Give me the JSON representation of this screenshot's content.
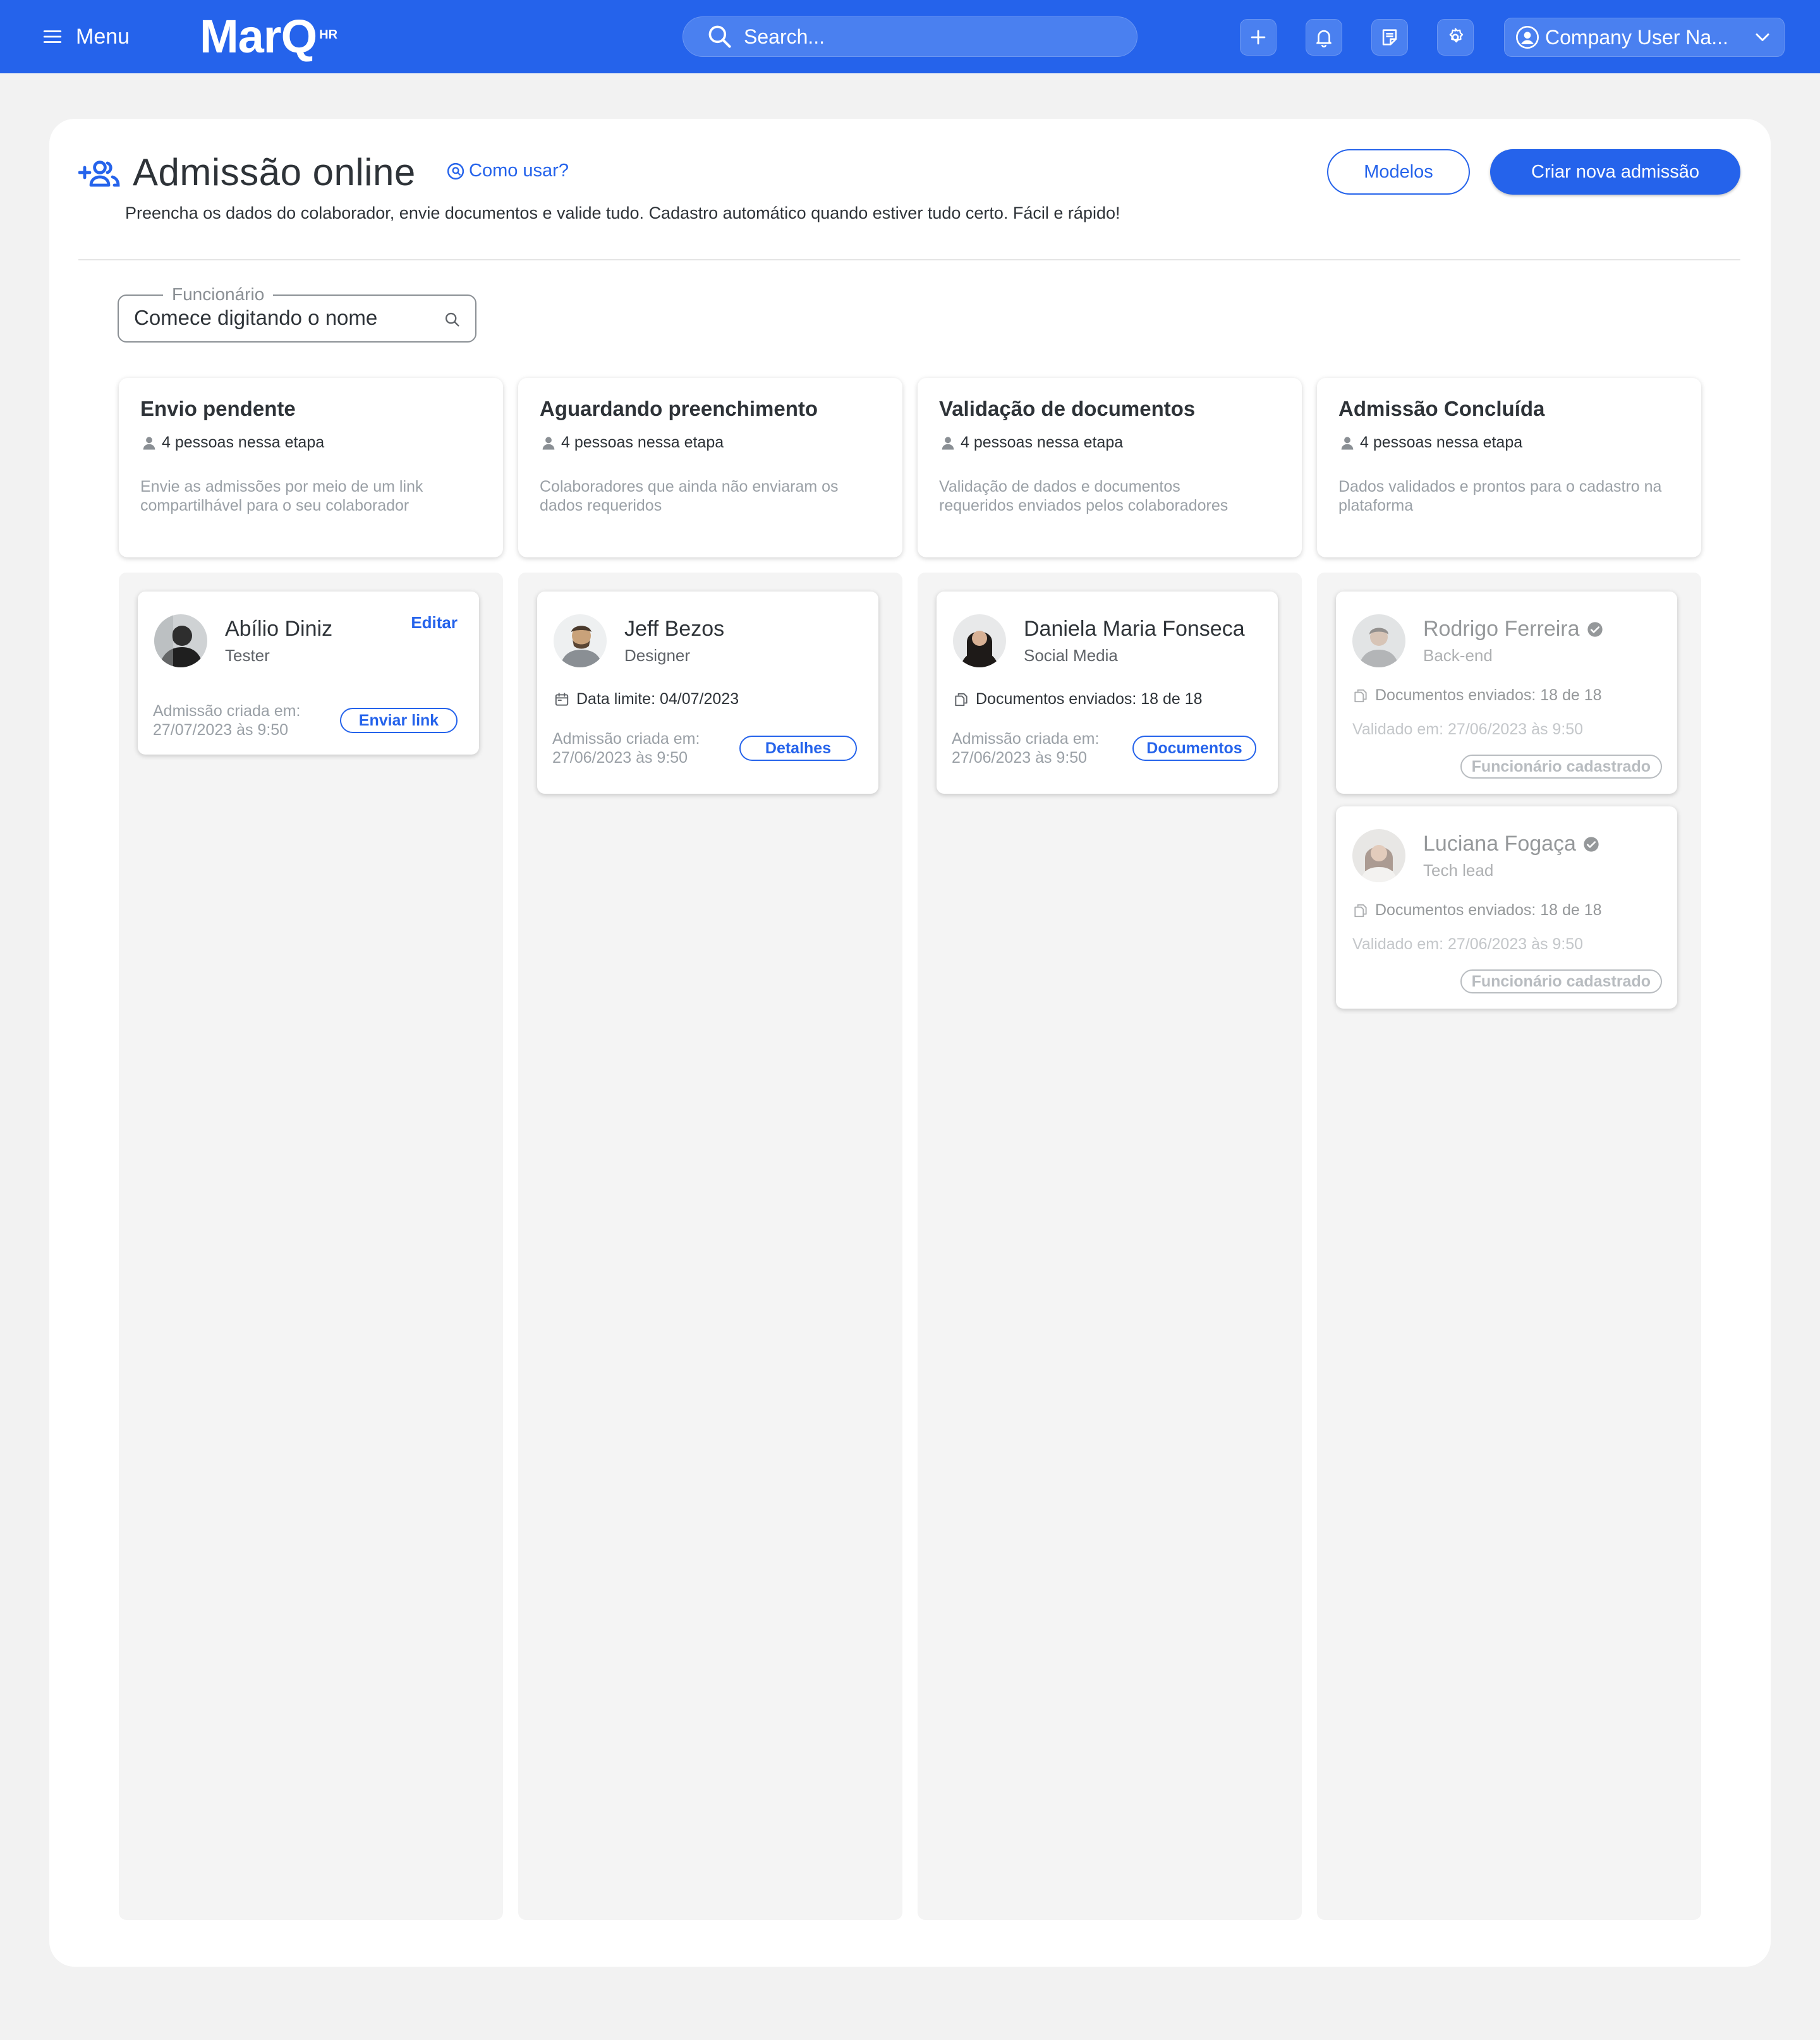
{
  "topbar": {
    "menu_label": "Menu",
    "logo_text": "MarQ",
    "logo_sup": "HR",
    "search_placeholder": "Search...",
    "user_name": "Company User Na...",
    "accent_color": "#2563eb"
  },
  "header": {
    "title": "Admissão online",
    "how_to": "Como usar?",
    "subtitle": "Preencha os dados do colaborador, envie documentos e valide tudo. Cadastro automático quando estiver tudo certo. Fácil e rápido!",
    "models_button": "Modelos",
    "create_button": "Criar nova admissão"
  },
  "filter": {
    "label": "Funcionário",
    "placeholder": "Comece digitando o nome"
  },
  "columns": [
    {
      "title": "Envio pendente",
      "count": "4 pessoas nessa etapa",
      "desc_1": "Envie as admissões por meio de um link",
      "desc_2": "compartilhável para o seu colaborador"
    },
    {
      "title": "Aguardando preenchimento",
      "count": "4 pessoas nessa etapa",
      "desc_1": "Colaboradores que ainda não enviaram os",
      "desc_2": "dados requeridos"
    },
    {
      "title": "Validação de documentos",
      "count": "4 pessoas nessa etapa",
      "desc_1": "Validação de dados e documentos",
      "desc_2": "requeridos enviados pelos colaboradores"
    },
    {
      "title": "Admissão Concluída",
      "count": "4 pessoas nessa etapa",
      "desc_1": "Dados validados e prontos para o cadastro na",
      "desc_2": "plataforma"
    }
  ],
  "cards": {
    "abilio": {
      "name": "Abílio Diniz",
      "role": "Tester",
      "edit": "Editar",
      "created_label": "Admissão criada em:",
      "created_date": "27/07/2023 às 9:50",
      "action": "Enviar link"
    },
    "jeff": {
      "name": "Jeff Bezos",
      "role": "Designer",
      "deadline_label": "Data limite:",
      "deadline_value": "04/07/2023",
      "created_label": "Admissão criada em:",
      "created_date": "27/06/2023 às 9:50",
      "action": "Detalhes"
    },
    "daniela": {
      "name": "Daniela Maria Fonseca",
      "role": "Social Media",
      "docs_label": "Documentos enviados:",
      "docs_value": "18 de 18",
      "created_label": "Admissão criada em:",
      "created_date": "27/06/2023 às 9:50",
      "action": "Documentos"
    },
    "rodrigo": {
      "name": "Rodrigo Ferreira",
      "role": "Back-end",
      "docs_label": "Documentos enviados:",
      "docs_value": "18 de 18",
      "validated": "Validado em: 27/06/2023 às 9:50",
      "status": "Funcionário cadastrado"
    },
    "luciana": {
      "name": "Luciana Fogaça",
      "role": "Tech lead",
      "docs_label": "Documentos enviados:",
      "docs_value": "18 de 18",
      "validated": "Validado em: 27/06/2023 às 9:50",
      "status": "Funcionário cadastrado"
    }
  }
}
